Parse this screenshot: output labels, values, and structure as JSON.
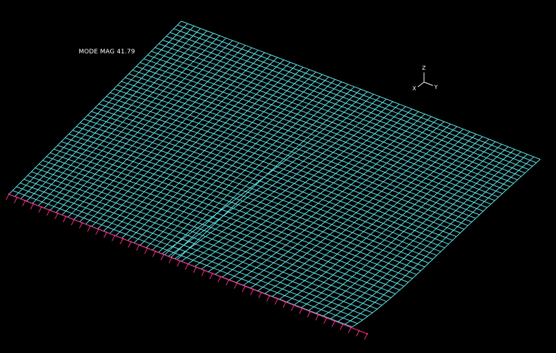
{
  "viewport": {
    "mode_label": "MODE MAG 41.79",
    "background_color": "#000000",
    "mesh_color": "#5fe8ee",
    "constraint_color": "#ff2a8a"
  },
  "triad": {
    "z_label": "Z",
    "x_label": "X",
    "y_label": "Y",
    "icon": "coordinate-triad-icon"
  }
}
